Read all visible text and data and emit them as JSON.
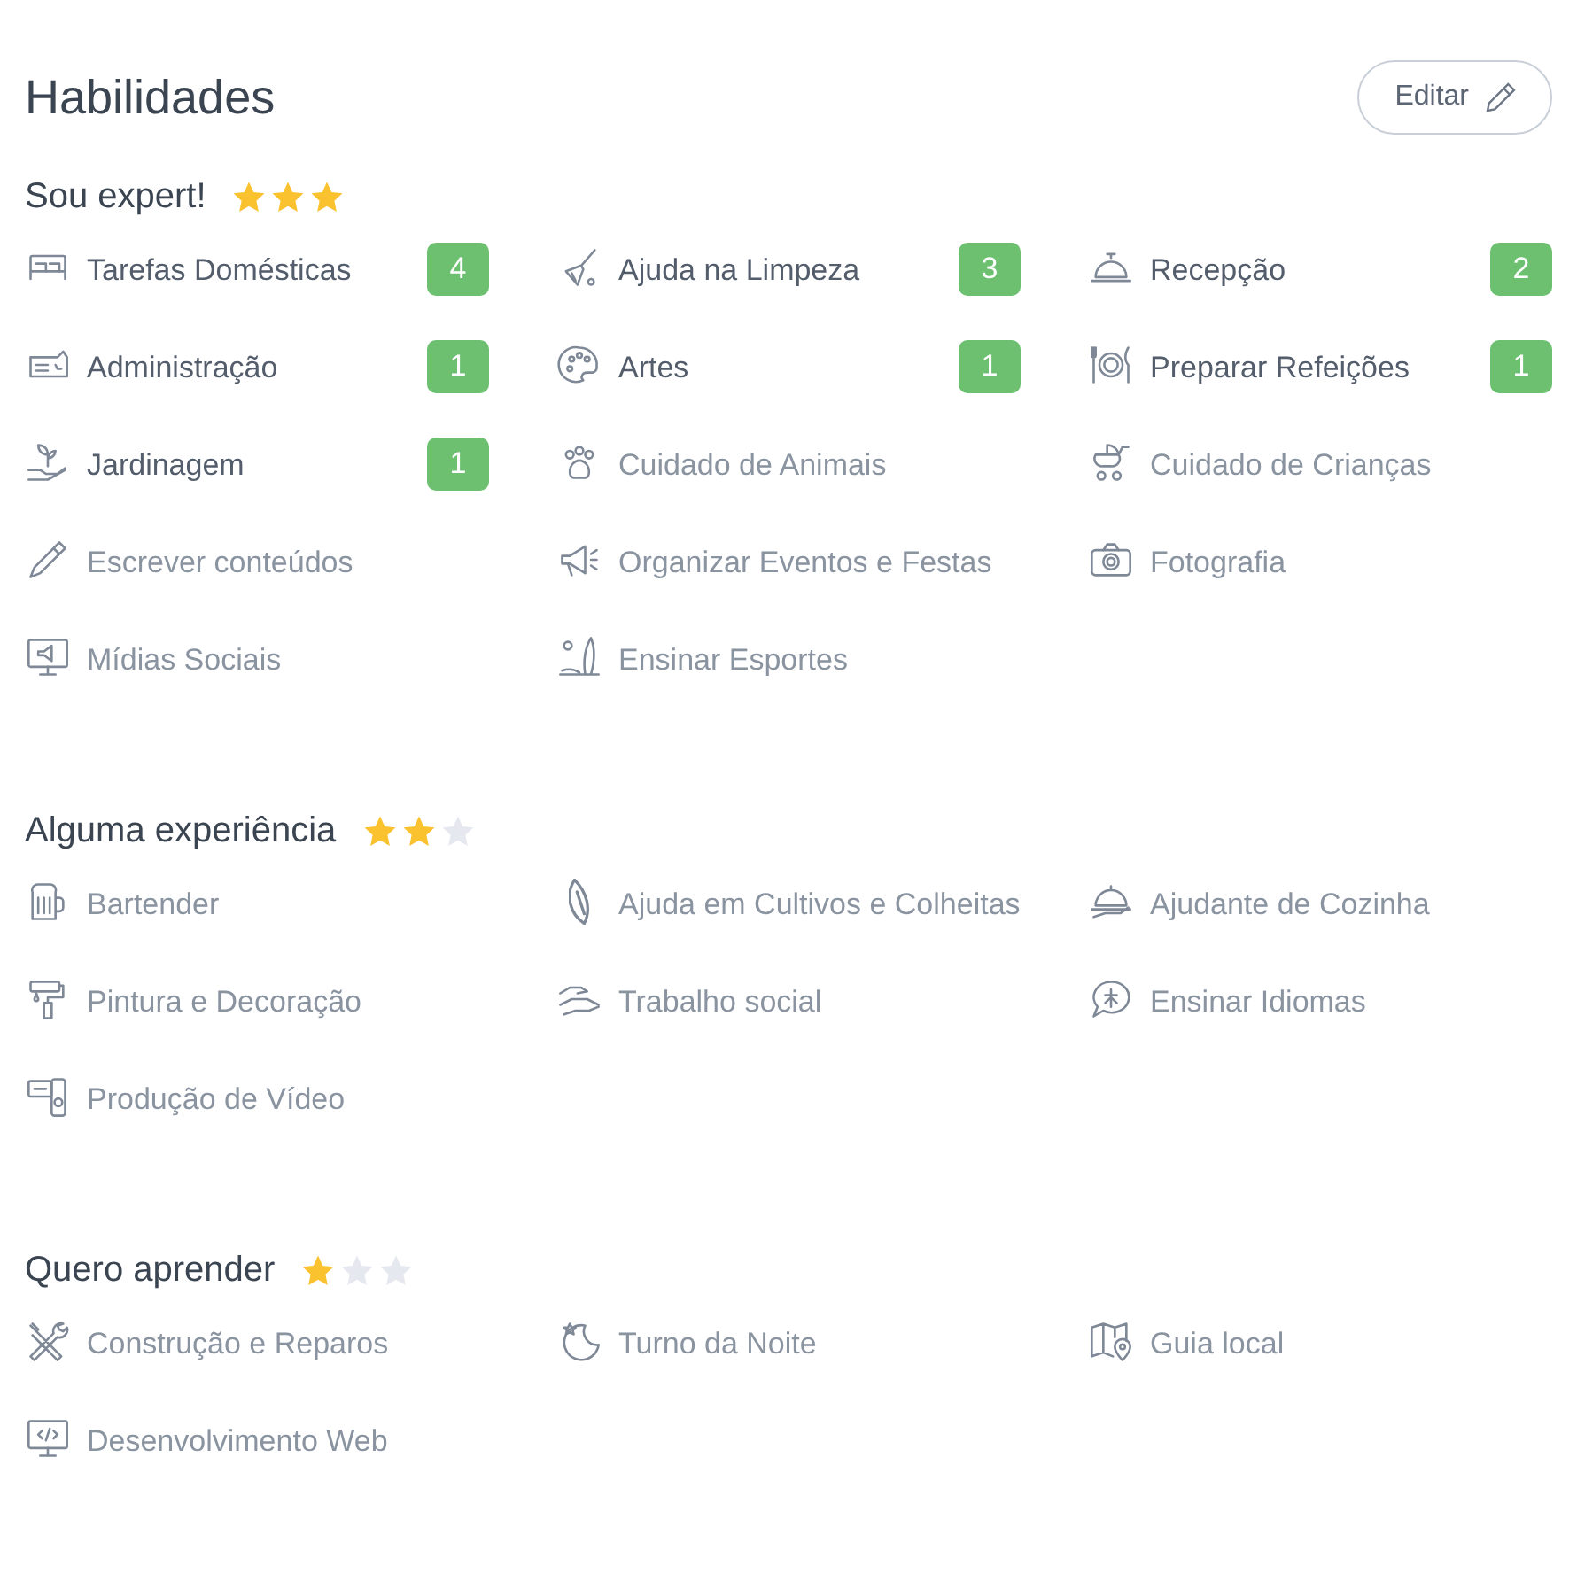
{
  "title": "Habilidades",
  "edit_button": "Editar",
  "sections": [
    {
      "title": "Sou expert!",
      "stars": 3,
      "items": [
        {
          "label": "Tarefas Domésticas",
          "count": "4"
        },
        {
          "label": "Ajuda na Limpeza",
          "count": "3"
        },
        {
          "label": "Recepção",
          "count": "2"
        },
        {
          "label": "Administração",
          "count": "1"
        },
        {
          "label": "Artes",
          "count": "1"
        },
        {
          "label": "Preparar Refeições",
          "count": "1"
        },
        {
          "label": "Jardinagem",
          "count": "1"
        },
        {
          "label": "Cuidado de Animais"
        },
        {
          "label": "Cuidado de Crianças"
        },
        {
          "label": "Escrever conteúdos"
        },
        {
          "label": "Organizar Eventos e Festas"
        },
        {
          "label": "Fotografia"
        },
        {
          "label": "Mídias Sociais"
        },
        {
          "label": "Ensinar Esportes"
        }
      ]
    },
    {
      "title": "Alguma experiência",
      "stars": 2,
      "items": [
        {
          "label": "Bartender"
        },
        {
          "label": "Ajuda em Cultivos e Colheitas"
        },
        {
          "label": "Ajudante de Cozinha"
        },
        {
          "label": "Pintura e Decoração"
        },
        {
          "label": "Trabalho social"
        },
        {
          "label": "Ensinar Idiomas"
        },
        {
          "label": "Produção de Vídeo"
        }
      ]
    },
    {
      "title": "Quero aprender",
      "stars": 1,
      "items": [
        {
          "label": "Construção e Reparos"
        },
        {
          "label": "Turno da Noite"
        },
        {
          "label": "Guia local"
        },
        {
          "label": "Desenvolvimento Web"
        }
      ]
    }
  ]
}
